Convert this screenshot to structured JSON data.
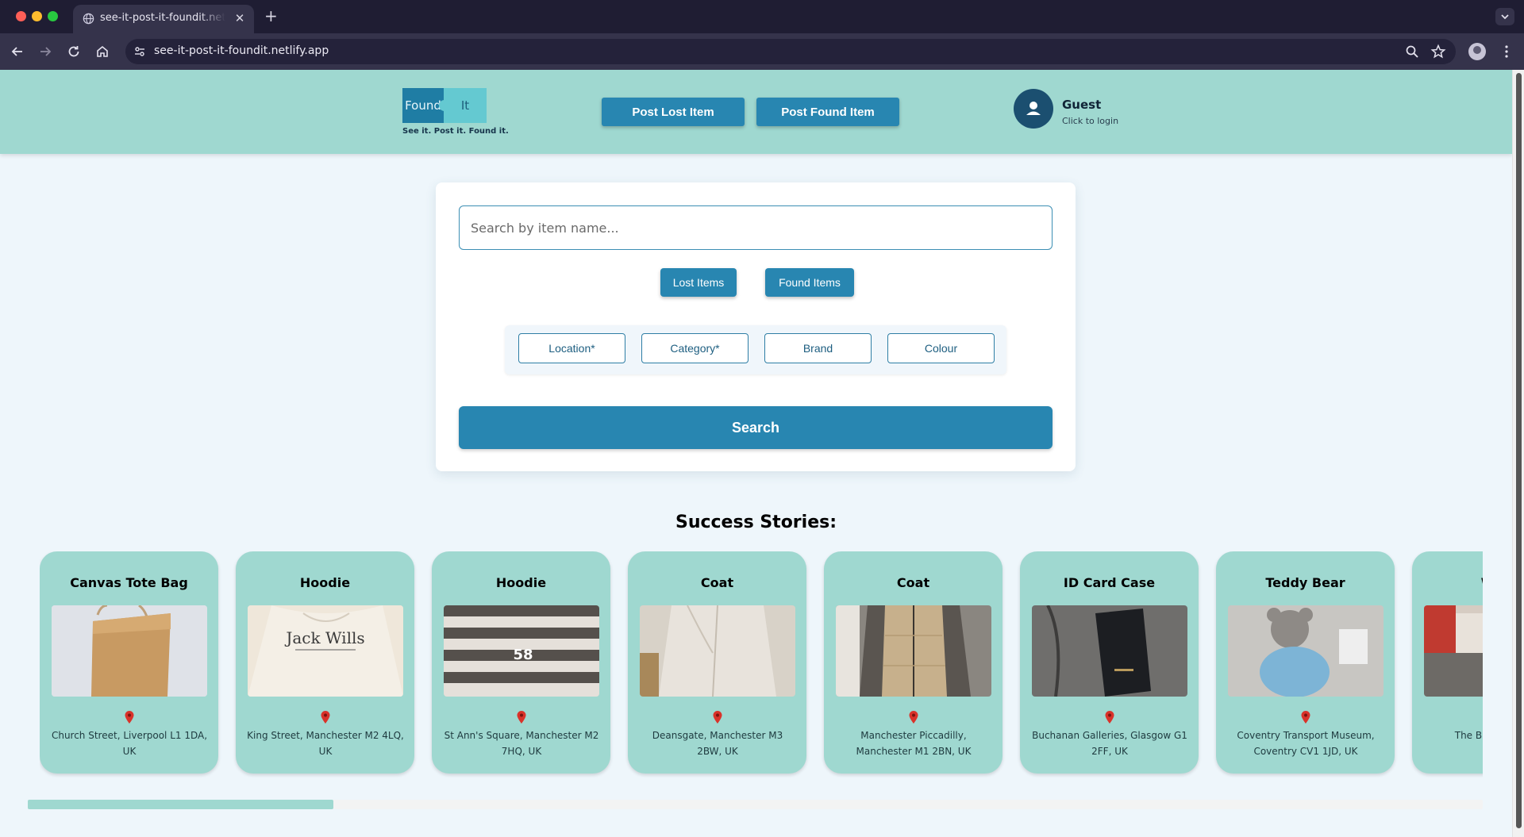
{
  "browser": {
    "tab_title": "see-it-post-it-foundit.netlify.app",
    "url": "see-it-post-it-foundit.netlify.app"
  },
  "header": {
    "logo": {
      "found": "Found",
      "it": "It",
      "tagline": "See it. Post it. Found it."
    },
    "post_lost_label": "Post Lost Item",
    "post_found_label": "Post Found Item",
    "user": {
      "name": "Guest",
      "subtitle": "Click to login",
      "icon": "user-icon"
    }
  },
  "search": {
    "placeholder": "Search by item name...",
    "value": "",
    "toggles": {
      "lost": "Lost Items",
      "found": "Found Items"
    },
    "filters": [
      "Location*",
      "Category*",
      "Brand",
      "Colour"
    ],
    "submit_label": "Search"
  },
  "stories": {
    "title": "Success Stories:",
    "items": [
      {
        "title": "Canvas Tote Bag",
        "location": "Church Street, Liverpool L1 1DA, UK"
      },
      {
        "title": "Hoodie",
        "location": "King Street, Manchester M2 4LQ, UK"
      },
      {
        "title": "Hoodie",
        "location": "St Ann's Square, Manchester M2 7HQ, UK"
      },
      {
        "title": "Coat",
        "location": "Deansgate, Manchester M3 2BW, UK"
      },
      {
        "title": "Coat",
        "location": "Manchester Piccadilly, Manchester M1 2BN, UK"
      },
      {
        "title": "ID Card Case",
        "location": "Buchanan Galleries, Glasgow G1 2FF, UK"
      },
      {
        "title": "Teddy Bear",
        "location": "Coventry Transport Museum, Coventry CV1 1JD, UK"
      },
      {
        "title": "Wat",
        "location": "The Broadwa"
      }
    ],
    "scroll_position": 0.21
  },
  "colors": {
    "header_bg": "#9fd8d0",
    "primary_button": "#2886b1",
    "page_bg": "#eef6fb",
    "pin": "#d9322a"
  }
}
